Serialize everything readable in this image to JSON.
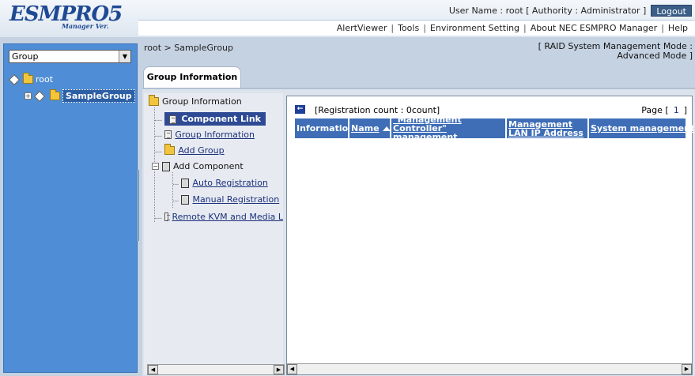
{
  "header": {
    "logo_main": "ESMPRO5",
    "logo_sub": "Manager Ver.",
    "user_text": "User Name :  root  [ Authority : Administrator ]",
    "logout_label": "Logout",
    "menu": [
      "AlertViewer",
      "Tools",
      "Environment Setting",
      "About NEC ESMPRO Manager",
      "Help"
    ]
  },
  "sidebar": {
    "group_select_value": "Group",
    "tree": [
      {
        "label": "root"
      },
      {
        "label": "SampleGroup",
        "selected": true
      }
    ]
  },
  "breadcrumb": "root > SampleGroup",
  "mode_text": "[ RAID System Management Mode : Advanced Mode ]",
  "tab_label": "Group Information",
  "nav": {
    "root": "Group Information",
    "items": [
      {
        "label": "Component Link",
        "active": true
      },
      {
        "label": "Group Information"
      },
      {
        "label": "Add Group"
      },
      {
        "label": "Add Component"
      },
      {
        "label": "Auto Registration"
      },
      {
        "label": "Manual Registration"
      },
      {
        "label": "Remote KVM and Media L"
      }
    ]
  },
  "main": {
    "registration_count": "[Registration count : 0count]",
    "page_label": "Page [",
    "page_number": "1",
    "page_close": "]",
    "columns": [
      {
        "label": "Information"
      },
      {
        "label": "Name"
      },
      {
        "label": "\"Management Controller\" management"
      },
      {
        "label": "Management LAN IP Address"
      },
      {
        "label": "System management"
      }
    ]
  },
  "colors": {
    "sidebar_bg": "#4f8ed6",
    "table_header_bg": "#3f6eb7",
    "active_nav_bg": "#2e4a94"
  }
}
